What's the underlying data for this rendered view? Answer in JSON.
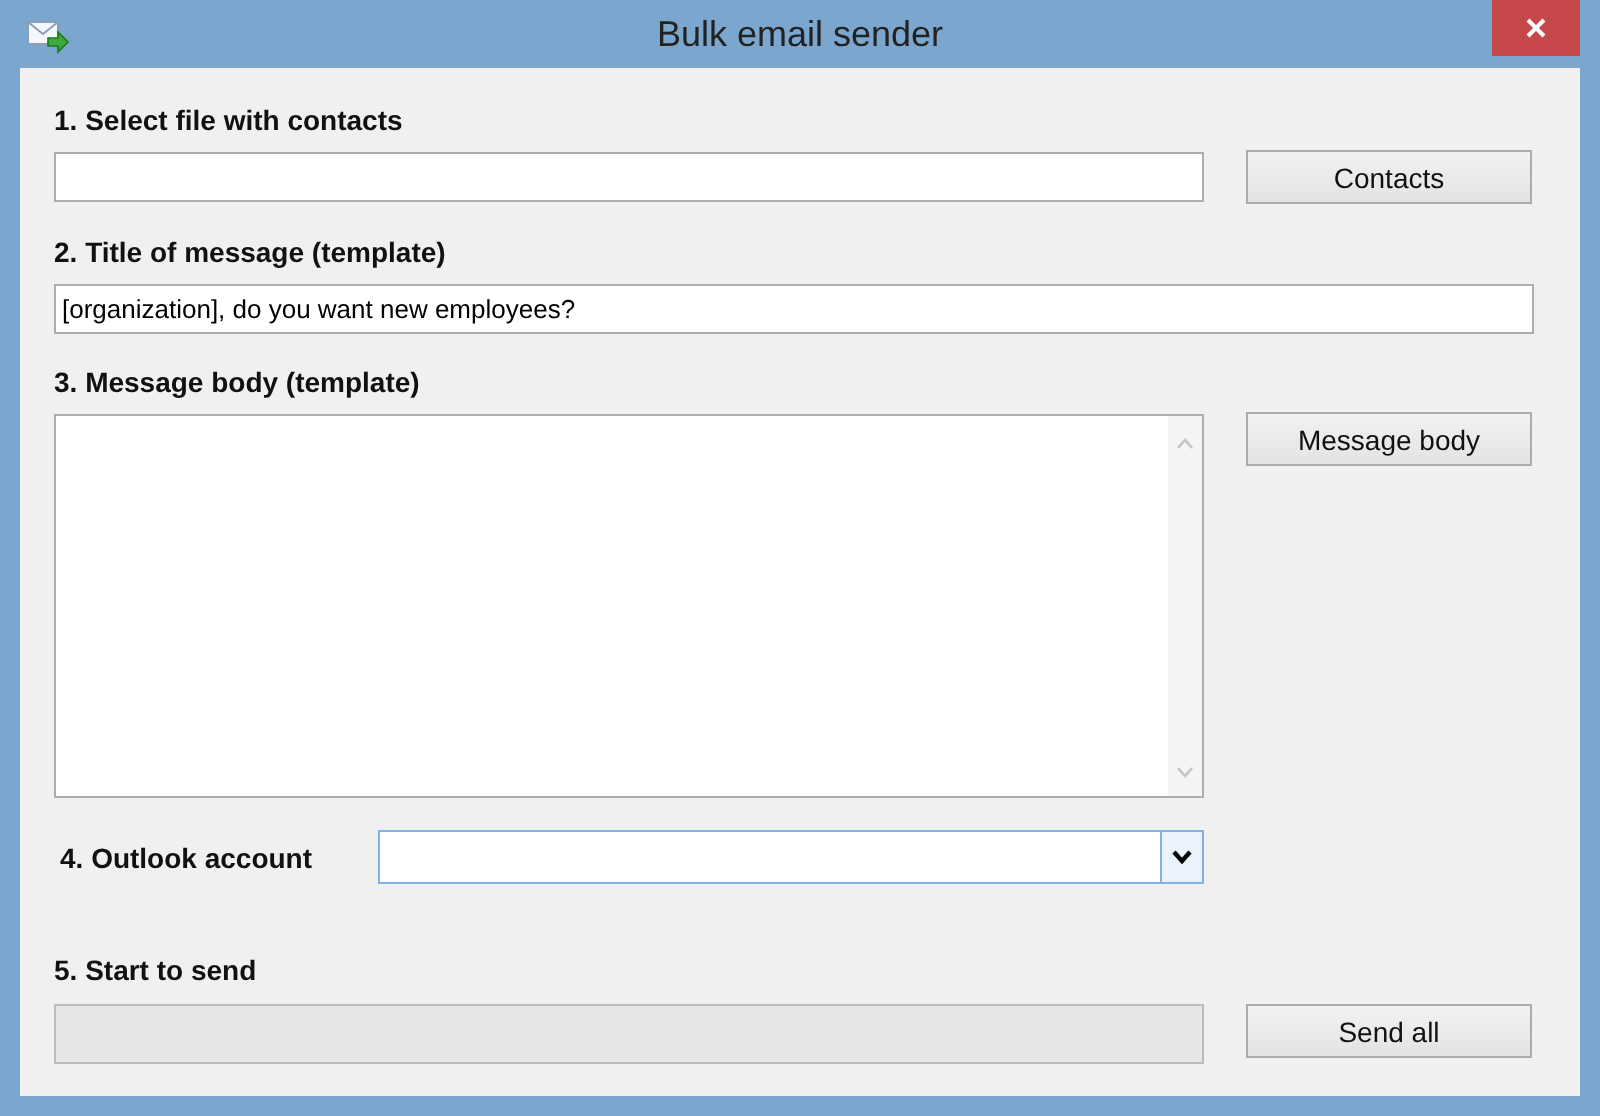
{
  "window": {
    "title": "Bulk email sender"
  },
  "sections": [
    {
      "kind": "file",
      "label": "1. Select file with contacts",
      "button": "Contacts"
    },
    {
      "kind": "text",
      "label": "2. Title of message (template)",
      "value": "[organization], do you want new employees?"
    },
    {
      "kind": "body",
      "label": "3. Message body (template)",
      "button": "Message body"
    },
    {
      "kind": "combo",
      "label": "4. Outlook account"
    },
    {
      "kind": "progress",
      "label": "5. Start to send",
      "level": 0,
      "button": "Send all"
    }
  ]
}
